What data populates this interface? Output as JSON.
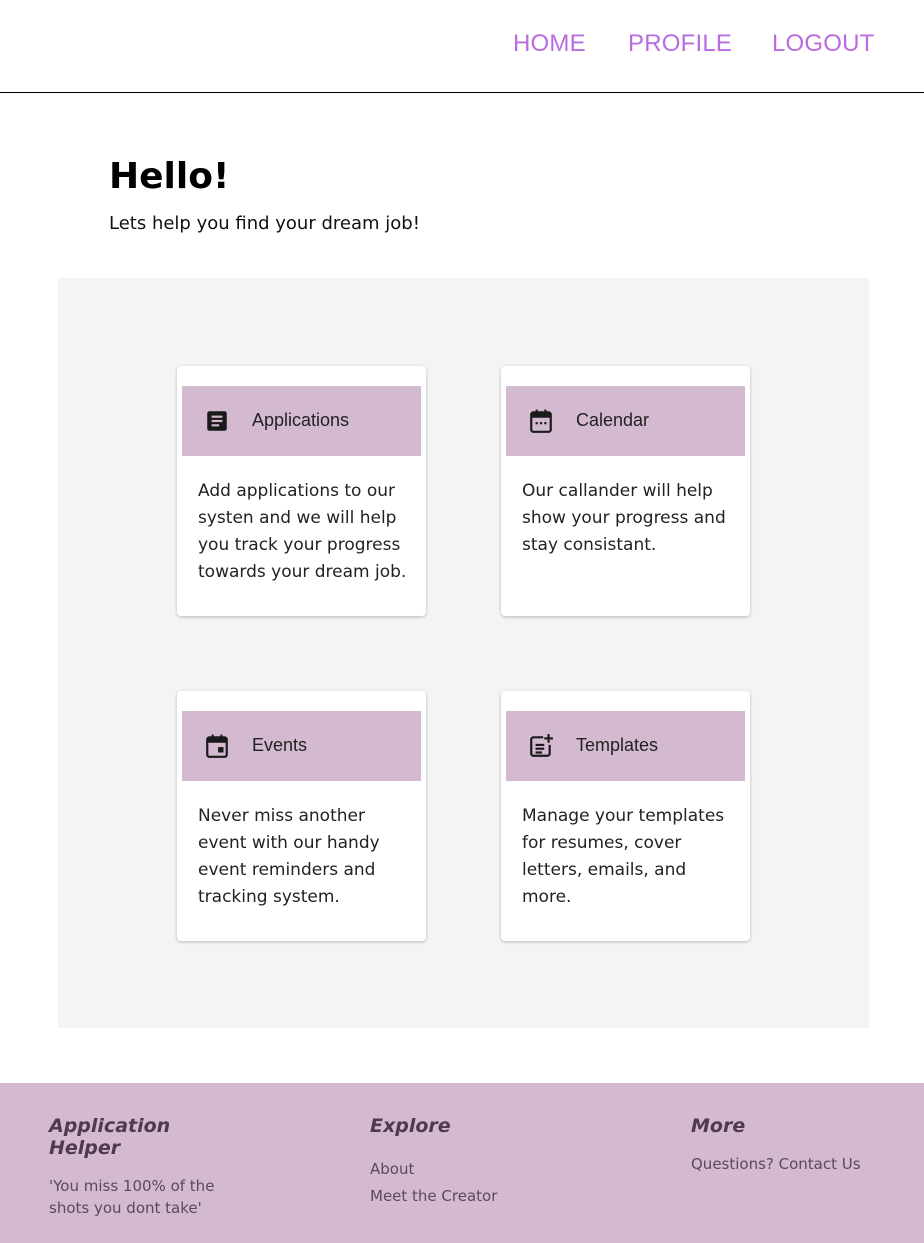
{
  "nav": {
    "home": "HOME",
    "profile": "PROFILE",
    "logout": "LOGOUT"
  },
  "hero": {
    "title": "Hello!",
    "subtitle": "Lets help you find your dream job!"
  },
  "cards": [
    {
      "title": "Applications",
      "icon": "document-icon",
      "description": "Add applications to our systen and we will help you track your progress towards your dream job."
    },
    {
      "title": "Calendar",
      "icon": "calendar-icon",
      "description": "Our callander will help show your progress and stay consistant."
    },
    {
      "title": "Events",
      "icon": "event-icon",
      "description": "Never miss another event with our handy event reminders and tracking system."
    },
    {
      "title": "Templates",
      "icon": "post-add-icon",
      "description": "Manage your templates for resumes, cover letters, emails, and more."
    }
  ],
  "footer": {
    "brand": {
      "title": "Application Helper",
      "quote": "'You miss 100% of the shots you dont take'"
    },
    "explore": {
      "title": "Explore",
      "links": [
        "About",
        "Meet the Creator"
      ]
    },
    "more": {
      "title": "More",
      "contact": "Questions? Contact Us"
    }
  },
  "colors": {
    "accent": "#b96be0",
    "card_header": "#d3bad1",
    "footer_bg": "#d3bad1",
    "panel_bg": "#f4f4f4"
  }
}
